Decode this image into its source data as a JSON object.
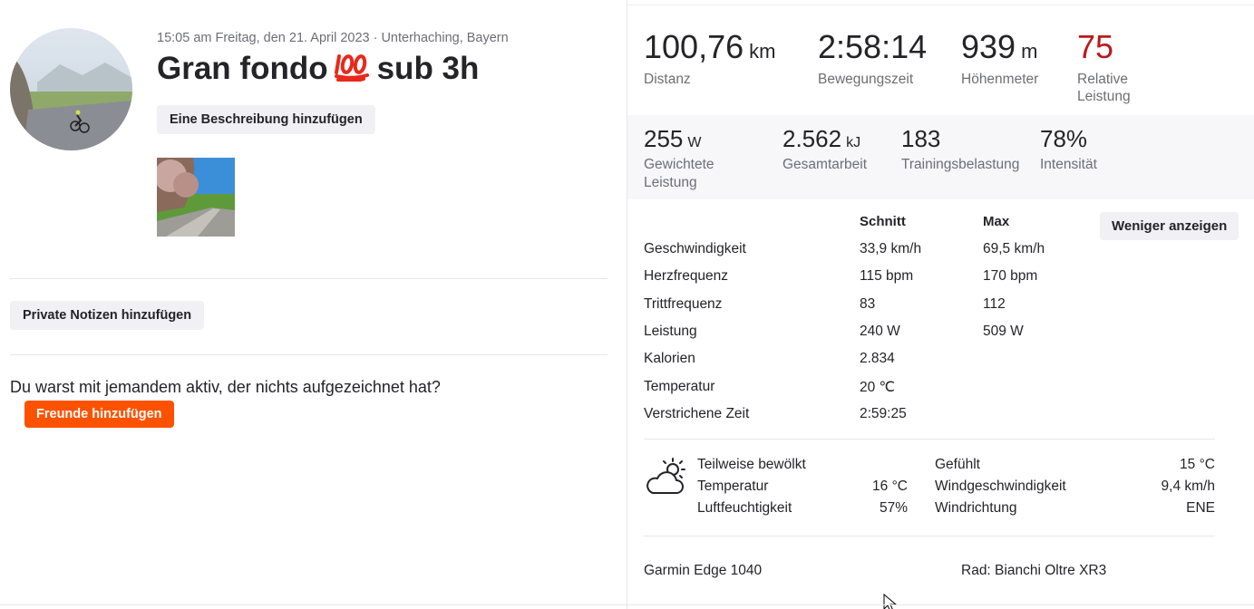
{
  "activity": {
    "meta": "15:05 am Freitag, den 21. April 2023 · Unterhaching, Bayern",
    "title_prefix": "Gran fondo",
    "title_emoji": "💯",
    "title_suffix": "sub 3h",
    "add_description_label": "Eine Beschreibung hinzufügen",
    "add_private_notes_label": "Private Notizen hinzufügen",
    "question": "Du warst mit jemandem aktiv, der nichts aufgezeichnet hat?",
    "add_friends_label": "Freunde hinzufügen",
    "accent_color": "#fc5200"
  },
  "primary_stats": [
    {
      "value": "100,76",
      "unit": "km",
      "label": "Distanz"
    },
    {
      "value": "2:58:14",
      "unit": "",
      "label": "Bewegungszeit"
    },
    {
      "value": "939",
      "unit": "m",
      "label": "Höhenmeter"
    },
    {
      "value": "75",
      "unit": "",
      "label": "Relative Leistung",
      "color": "#b71c1c"
    }
  ],
  "secondary_stats": [
    {
      "value": "255",
      "unit": "W",
      "label": "Gewichtete Leistung"
    },
    {
      "value": "2.562",
      "unit": "kJ",
      "label": "Gesamtarbeit"
    },
    {
      "value": "183",
      "unit": "",
      "label": "Trainingsbelastung"
    },
    {
      "value": "78%",
      "unit": "",
      "label": "Intensität"
    }
  ],
  "details": {
    "col_avg": "Schnitt",
    "col_max": "Max",
    "show_less_label": "Weniger anzeigen",
    "rows": [
      {
        "label": "Geschwindigkeit",
        "avg": "33,9 km/h",
        "max": "69,5 km/h"
      },
      {
        "label": "Herzfrequenz",
        "avg": "115 bpm",
        "max": "170 bpm"
      },
      {
        "label": "Trittfrequenz",
        "avg": "83",
        "max": "112"
      },
      {
        "label": "Leistung",
        "avg": "240 W",
        "max": "509 W"
      },
      {
        "label": "Kalorien",
        "avg": "2.834",
        "max": ""
      },
      {
        "label": "Temperatur",
        "avg": "20 ℃",
        "max": ""
      },
      {
        "label": "Verstrichene Zeit",
        "avg": "2:59:25",
        "max": ""
      }
    ]
  },
  "weather": {
    "icon": "partly-cloudy-icon",
    "condition": "Teilweise bewölkt",
    "temp_label": "Temperatur",
    "temp_value": "16 °C",
    "humidity_label": "Luftfeuchtigkeit",
    "humidity_value": "57%",
    "feels_label": "Gefühlt",
    "feels_value": "15 °C",
    "wind_speed_label": "Windgeschwindigkeit",
    "wind_speed_value": "9,4 km/h",
    "wind_dir_label": "Windrichtung",
    "wind_dir_value": "ENE"
  },
  "equipment": {
    "device": "Garmin Edge 1040",
    "bike": "Rad: Bianchi Oltre XR3"
  }
}
